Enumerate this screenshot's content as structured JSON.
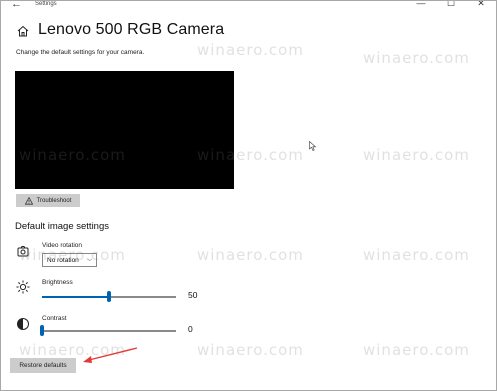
{
  "window": {
    "app_title": "Settings",
    "back_symbol": "←",
    "controls": [
      "—",
      "☐",
      "✕"
    ]
  },
  "header": {
    "title": "Lenovo 500 RGB Camera",
    "subtitle": "Change the default settings for your camera.",
    "home_icon": "home-icon"
  },
  "troubleshoot": {
    "label": "Troubleshoot",
    "icon": "warning-icon"
  },
  "image_settings": {
    "heading": "Default image settings",
    "video_rotation": {
      "label": "Video rotation",
      "value": "No rotation",
      "icon": "camera-rotate-icon"
    },
    "brightness": {
      "label": "Brightness",
      "value": "50",
      "level": 0.5,
      "icon": "sun-icon"
    },
    "contrast": {
      "label": "Contrast",
      "value": "0",
      "level": 0,
      "icon": "contrast-icon"
    }
  },
  "footer": {
    "restore_label": "Restore defaults"
  },
  "watermark": "winaero.com",
  "colors": {
    "accent": "#0063b1",
    "button_bg": "#cccccc",
    "annotation_arrow": "#e53935",
    "preview_bg": "#000000"
  }
}
